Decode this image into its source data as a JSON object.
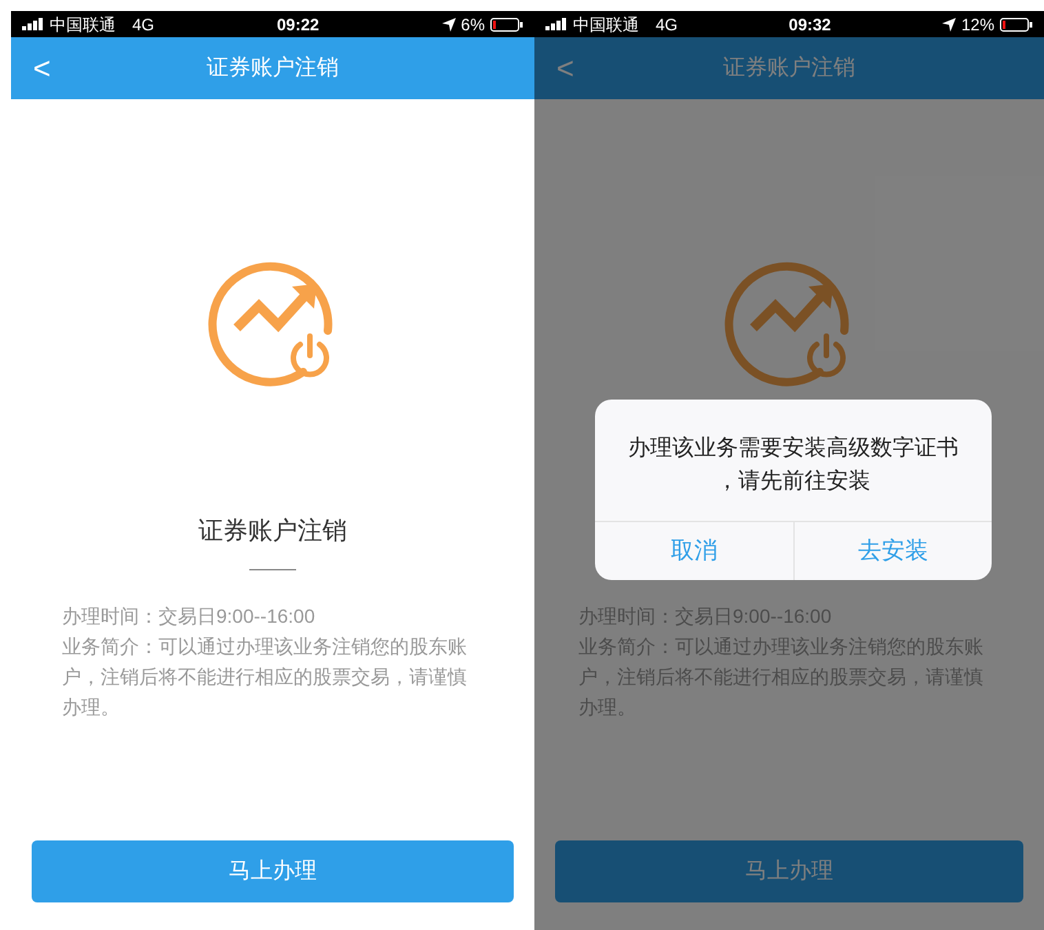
{
  "screens": [
    {
      "status_bar": {
        "carrier": "中国联通",
        "network": "4G",
        "time": "09:22",
        "battery": "6%"
      },
      "nav": {
        "back": "<",
        "title": "证券账户注销"
      },
      "heading": "证券账户注销",
      "info": [
        "办理时间：交易日9:00--16:00",
        "业务简介：可以通过办理该业务注销您的股东账户，注销后将不能进行相应的股票交易，请谨慎办理。"
      ],
      "button": "马上办理",
      "dimmed": false
    },
    {
      "status_bar": {
        "carrier": "中国联通",
        "network": "4G",
        "time": "09:32",
        "battery": "12%"
      },
      "nav": {
        "back": "<",
        "title": "证券账户注销"
      },
      "info": [
        "办理时间：交易日9:00--16:00",
        "业务简介：可以通过办理该业务注销您的股东账户，注销后将不能进行相应的股票交易，请谨慎办理。"
      ],
      "button": "马上办理",
      "dimmed": true,
      "dialog": {
        "message": "办理该业务需要安装高级数字证书，请先前往安装",
        "buttons": [
          "取消",
          "去安装"
        ]
      }
    }
  ]
}
